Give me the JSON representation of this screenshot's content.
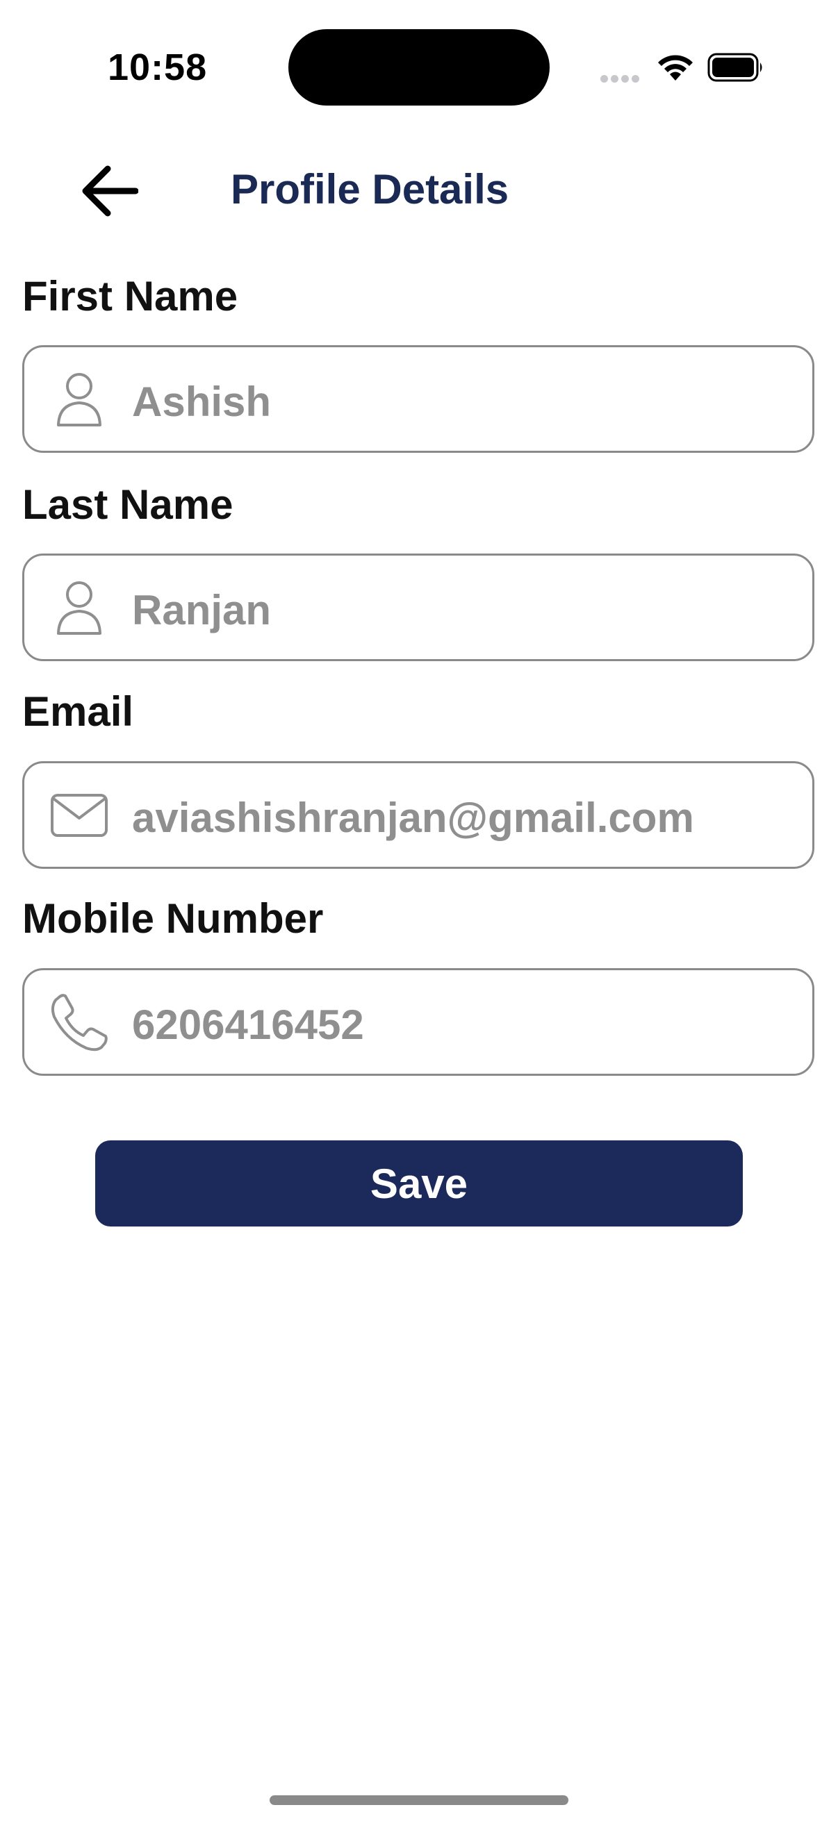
{
  "status_bar": {
    "time": "10:58"
  },
  "header": {
    "back_icon": "arrow-left-icon",
    "title": "Profile Details"
  },
  "form": {
    "first_name": {
      "label": "First Name",
      "value": "Ashish",
      "icon": "user-icon"
    },
    "last_name": {
      "label": "Last Name",
      "value": "Ranjan",
      "icon": "user-icon"
    },
    "email": {
      "label": "Email",
      "value": "aviashishranjan@gmail.com",
      "icon": "mail-icon"
    },
    "mobile": {
      "label": "Mobile Number",
      "value": "6206416452",
      "icon": "phone-icon"
    }
  },
  "actions": {
    "save_label": "Save"
  },
  "colors": {
    "primary": "#1b2a5a",
    "title": "#1b2a55",
    "input_text": "#8f8f8f",
    "border": "#8a8a8a"
  }
}
